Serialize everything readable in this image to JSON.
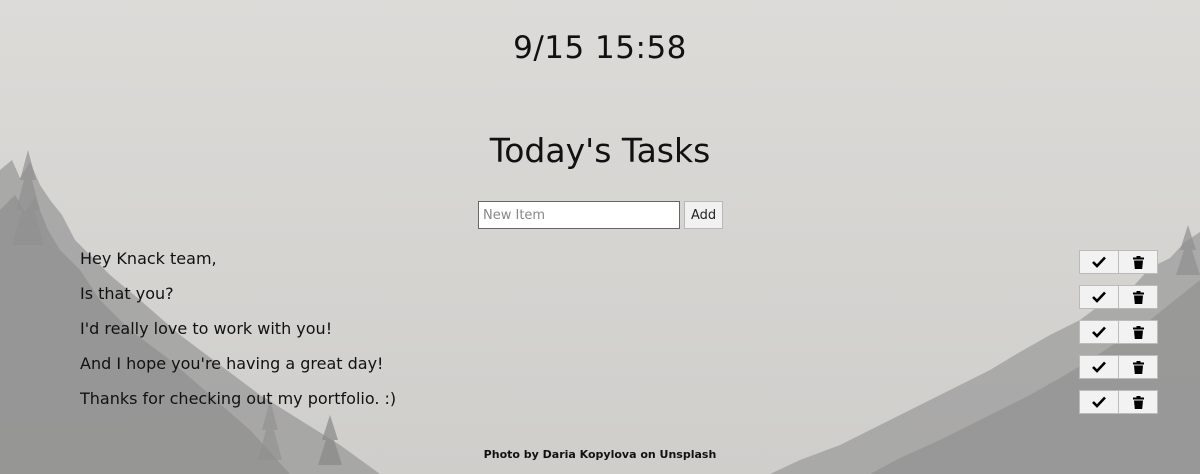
{
  "header": {
    "clock": "9/15 15:58",
    "title": "Today's Tasks"
  },
  "form": {
    "placeholder": "New Item",
    "add_label": "Add"
  },
  "tasks": [
    {
      "text": "Hey Knack team,"
    },
    {
      "text": "Is that you?"
    },
    {
      "text": "I'd really love to work with you!"
    },
    {
      "text": "And I hope you're having a great day!"
    },
    {
      "text": "Thanks for checking out my portfolio. :)"
    }
  ],
  "task_actions": {
    "complete_icon": "checkmark-icon",
    "delete_icon": "trash-icon"
  },
  "footer": {
    "credit": "Photo by Daria Kopylova on Unsplash"
  },
  "colors": {
    "sky": "#d9d8d5",
    "forest": "#8c8c8c"
  }
}
